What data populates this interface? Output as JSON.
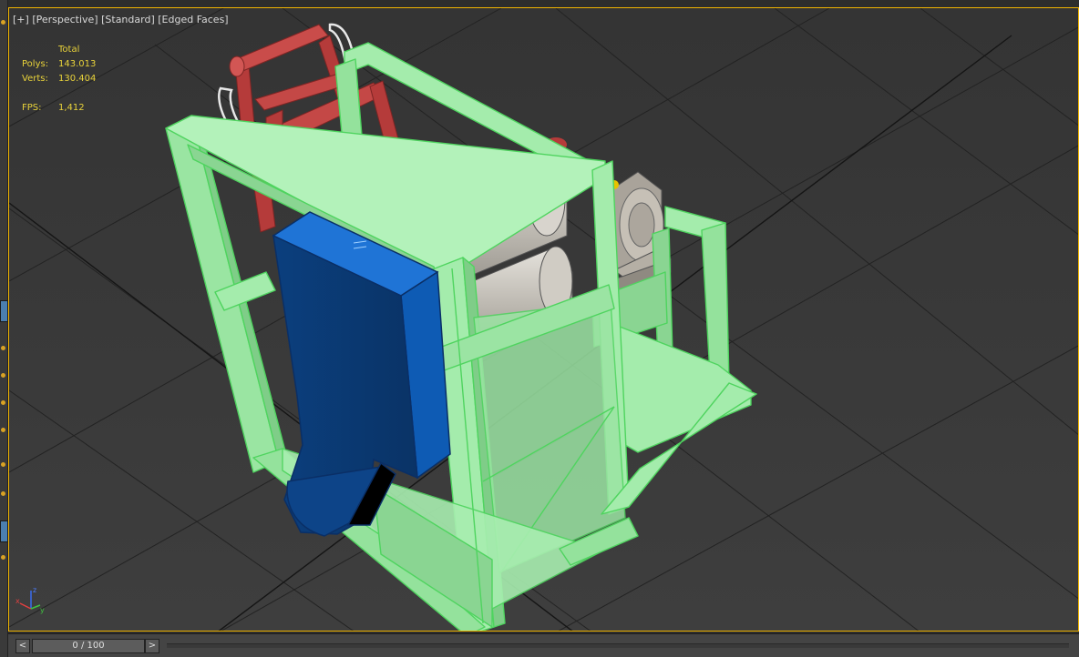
{
  "viewport": {
    "label": {
      "plus": "[+]",
      "view": "[Perspective]",
      "shading": "[Standard]",
      "mode": "[Edged Faces]"
    },
    "stats": {
      "total_header": "Total",
      "polys_label": "Polys:",
      "polys_value": "143.013",
      "verts_label": "Verts:",
      "verts_value": "130.404",
      "fps_label": "FPS:",
      "fps_value": "1,412"
    },
    "axis": {
      "x": "x",
      "y": "y",
      "z": "z"
    }
  },
  "timeline": {
    "prev": "<",
    "next": ">",
    "frame": "0 / 100"
  },
  "colors": {
    "selection_green": "#a8f0b0",
    "selection_edge": "#5fdc6a",
    "hopper_blue": "#1f6fd0",
    "handle_red": "#c34a48",
    "viewport_border": "#f0b400",
    "stats_text": "#e8d23a"
  }
}
